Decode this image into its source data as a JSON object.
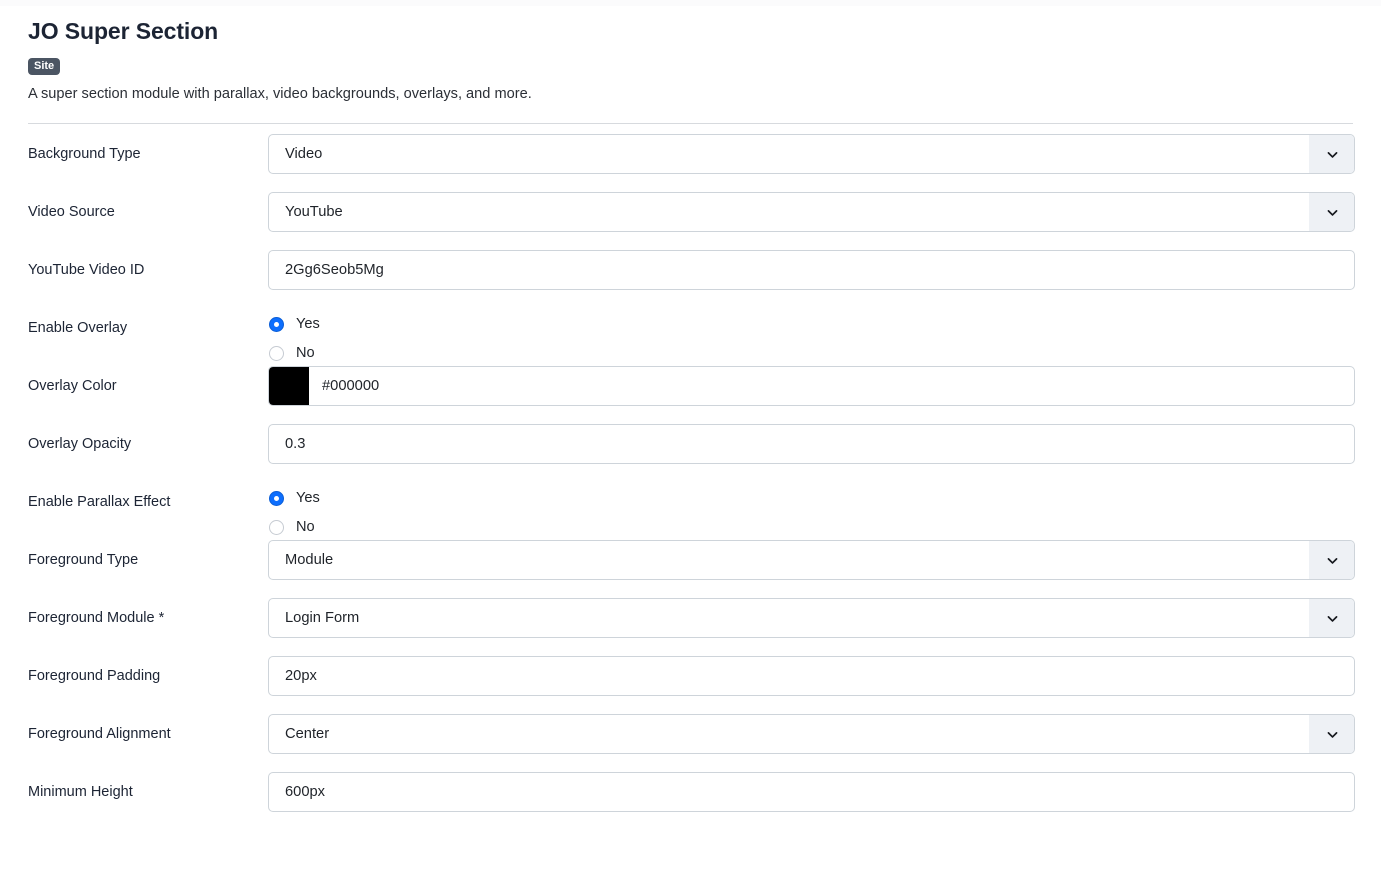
{
  "header": {
    "title": "JO Super Section",
    "badge": "Site",
    "description": "A super section module with parallax, video backgrounds, overlays, and more."
  },
  "icons": {
    "chevron_down": "chevron-down-icon"
  },
  "colors": {
    "accent": "#0d6efd",
    "badge_bg": "#4b5563",
    "border": "#ced4da",
    "chevron_bg": "#eef1f5",
    "label_text": "#1c2434"
  },
  "fields": [
    {
      "label": "Background Type",
      "type": "select",
      "value": "Video"
    },
    {
      "label": "Video Source",
      "type": "select",
      "value": "YouTube"
    },
    {
      "label": "YouTube Video ID",
      "type": "text",
      "value": "2Gg6Seob5Mg"
    },
    {
      "label": "Enable Overlay",
      "type": "radio",
      "options": [
        "Yes",
        "No"
      ],
      "value": "Yes"
    },
    {
      "label": "Overlay Color",
      "type": "color",
      "value": "#000000",
      "swatch": "#000000"
    },
    {
      "label": "Overlay Opacity",
      "type": "text",
      "value": "0.3"
    },
    {
      "label": "Enable Parallax Effect",
      "type": "radio",
      "options": [
        "Yes",
        "No"
      ],
      "value": "Yes"
    },
    {
      "label": "Foreground Type",
      "type": "select",
      "value": "Module"
    },
    {
      "label": "Foreground Module *",
      "type": "select",
      "value": "Login Form"
    },
    {
      "label": "Foreground Padding",
      "type": "text",
      "value": "20px"
    },
    {
      "label": "Foreground Alignment",
      "type": "select",
      "value": "Center"
    },
    {
      "label": "Minimum Height",
      "type": "text",
      "value": "600px"
    }
  ]
}
